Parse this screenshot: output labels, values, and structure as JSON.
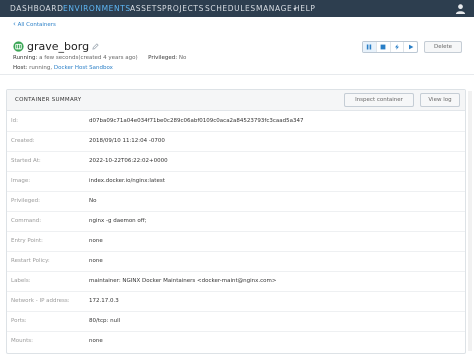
{
  "nav": {
    "items": [
      {
        "label": "DASHBOARD",
        "active": false
      },
      {
        "label": "ENVIRONMENTS",
        "active": true
      },
      {
        "label": "ASSETS",
        "active": false
      },
      {
        "label": "PROJECTS",
        "active": false
      },
      {
        "label": "SCHEDULES",
        "active": false
      },
      {
        "label": "MANAGE",
        "active": false
      },
      {
        "label": "HELP",
        "active": false
      }
    ],
    "manage_caret": "▾",
    "user_icon": "user-icon"
  },
  "breadcrumb": {
    "arrow": "‹",
    "label": "All Containers"
  },
  "container": {
    "icon": "container-icon",
    "name": "grave_borg",
    "running_label": "Running:",
    "running_value": "a few seconds",
    "created_value": "(created 4 years ago)",
    "privileged_label": "Privileged:",
    "privileged_value": "No",
    "host_label": "Host:",
    "host_status": "running,",
    "host_link": "Docker Host Sandbox"
  },
  "controls": {
    "icons": [
      "pause-icon",
      "stop-icon",
      "restart-icon",
      "play-icon"
    ],
    "active_icon": "pause-icon",
    "delete_label": "Delete"
  },
  "summary": {
    "title": "CONTAINER SUMMARY",
    "inspect_label": "Inspect container",
    "viewlog_label": "View log",
    "rows": [
      {
        "key": "Id:",
        "value": "d07ba09c71a04e034f71be0c289c06abf0109c0aca2a84523793fc3caad5a347"
      },
      {
        "key": "Created:",
        "value": "2018/09/10 11:12:04 -0700"
      },
      {
        "key": "Started At:",
        "value": "2022-10-22T06:22:02+0000"
      },
      {
        "key": "Image:",
        "value": "index.docker.io/nginx:latest"
      },
      {
        "key": "Privileged:",
        "value": "No"
      },
      {
        "key": "Command:",
        "value": "nginx -g daemon off;"
      },
      {
        "key": "Entry Point:",
        "value": "none"
      },
      {
        "key": "Restart Policy:",
        "value": "none"
      },
      {
        "key": "Labels:",
        "value": "maintainer: NGINX Docker Maintainers <docker-maint@nginx.com>"
      },
      {
        "key": "Network - IP address:",
        "value": "172.17.0.3"
      },
      {
        "key": "Ports:",
        "value": "80/tcp: null"
      },
      {
        "key": "Mounts:",
        "value": "none"
      }
    ]
  },
  "colors": {
    "nav_bg": "#2d3e4f",
    "nav_active": "#5fb7f5",
    "link": "#2a7fc7",
    "status_green": "#3aa655"
  }
}
